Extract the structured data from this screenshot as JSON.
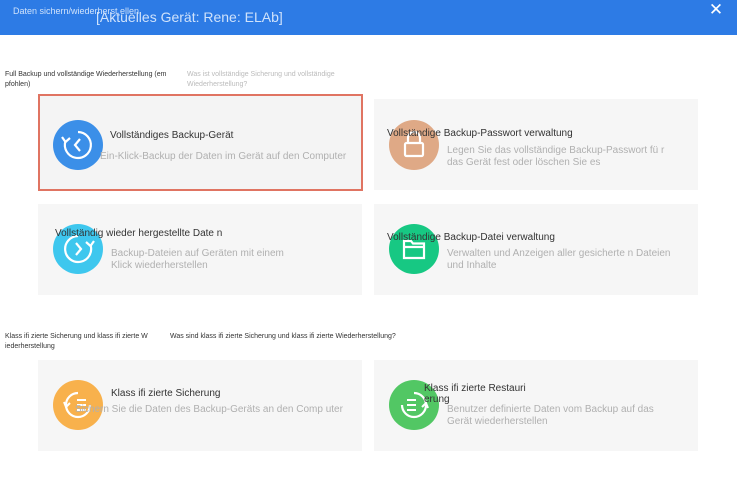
{
  "titlebar": {
    "left_label": "Daten sichern/wiederherst ellen",
    "device_label": "[Aktuelles Gerät: Rene: ELAb]",
    "close_label": "✕"
  },
  "full_backup_section": {
    "label": "Full Backup und vollständige Wiederherstellung (em pfohlen)",
    "help_link": "Was ist vollständige Sicherung und vollständige Wiederherstellung?"
  },
  "classified_section": {
    "label": "Klass ifi zierte Sicherung und klass ifi zierte W iederherstellung",
    "help_link": "Was sind klass ifi zierte Sicherung und klass ifi zierte Wiederherstellung?"
  },
  "cards": {
    "full_backup": {
      "title": "Vollständiges Backup-Gerät",
      "desc": "Ein-Klick-Backup der Daten im Gerät auf den Computer",
      "icon": "backup-clock-icon",
      "color": "#3b8fe8"
    },
    "password": {
      "title": "Vollständige Backup-Passwort verwaltung",
      "desc": "Legen Sie das vollständige Backup-Passwort fü r das Gerät fest oder löschen Sie es",
      "icon": "lock-icon",
      "color": "#dfa986"
    },
    "full_restore": {
      "title": "Vollständig wieder hergestellte Date n",
      "desc": "Backup-Dateien auf Geräten mit einem Klick wiederherstellen",
      "icon": "restore-clock-icon",
      "color": "#3ec7ee"
    },
    "file_management": {
      "title": "Vollständige Backup-Datei verwaltung",
      "desc": "Verwalten und Anzeigen aller gesicherte n Dateien und Inhalte",
      "icon": "folder-icon",
      "color": "#17c883"
    },
    "classified_backup": {
      "title": "Klass ifi zierte Sicherung",
      "desc": "Sichern Sie die Daten des Backup-Geräts an den Comp uter",
      "icon": "list-backup-icon",
      "color": "#f8b14c"
    },
    "classified_restore": {
      "title": "Klass ifi zierte Restauri erung",
      "desc": "Benutzer definierte Daten vom Backup auf das Gerät wiederherstellen",
      "icon": "list-restore-icon",
      "color": "#52c764"
    }
  }
}
